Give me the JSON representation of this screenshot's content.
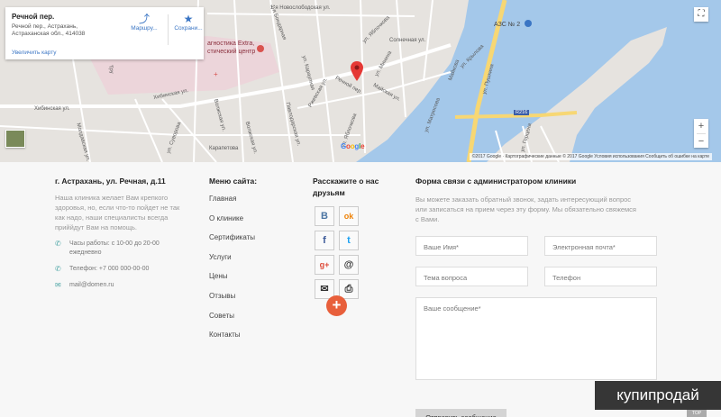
{
  "map": {
    "card": {
      "title": "Речной пер.",
      "address": "Речной пер., Астрахань, Астраханская обл., 414038",
      "enlarge": "Увеличить карту",
      "route": "Маршру...",
      "save": "Сохрани..."
    },
    "labels": {
      "novoslobodskaya": "1-я Новослободская ул.",
      "yablochkova1": "ул. Яблочкова",
      "yablochkova2": "ул. Яблочкова",
      "solnechnaya": "Солнечная ул.",
      "bondarnaya": "1-я Бондарная",
      "khibinskaya1": "Хибинская ул.",
      "khibinskaya2": "Хибинская ул.",
      "tru": "Тру",
      "moldavskaya": "Молдавская ул.",
      "suvorova": "ул. Суворова",
      "volzhskaya1": "Волжская ул.",
      "volzhskaya2": "Волжская ул.",
      "pavlodarskaya": "Павлодарская ул.",
      "karaulnaya": "ул. Караулная",
      "rechnoy": "Речной пер.",
      "mayskaya": "Майская ул.",
      "karapetova": "Карапетова",
      "rzhevskaya": "Ржевская ул.",
      "minina": "ул. Минина",
      "matrosova": "ул. Матросова",
      "maykova": "Майкова",
      "krylova": "ул. Крылова",
      "pushkina": "ул. Пушкина",
      "gertsena": "ул. Герцена",
      "r216": "R216",
      "azs": "АЗС № 2",
      "clinic1": "агностика Extra,",
      "clinic2": "стический центр"
    },
    "footer": "©2017 Google · Картографические данные © 2017 Google     Условия использования     Сообщить об ошибке на карте",
    "google": [
      "G",
      "o",
      "o",
      "g",
      "l",
      "e"
    ],
    "zoom_in": "+",
    "zoom_out": "−",
    "fullscreen": "⛶"
  },
  "contacts": {
    "title": "г. Астрахань, ул. Речная, д.11",
    "about": "Наша клиника желает Вам крепкого здоровья, но, если что-то пойдет не так как надо, наши специалисты всегда приййдут Вам на помощь.",
    "hours": "Часы работы: с 10-00 до 20-00 ежедневно",
    "phone": "Телефон: +7 000 000-00-00",
    "email": "mail@domen.ru"
  },
  "menu": {
    "title": "Меню сайта:",
    "items": [
      "Главная",
      "О клинике",
      "Сертификаты",
      "Услуги",
      "Цены",
      "Отзывы",
      "Советы",
      "Контакты"
    ]
  },
  "share": {
    "title": "Расскажите о нас друзьям",
    "buttons": [
      {
        "icon": "vk-icon",
        "glyph": "B"
      },
      {
        "icon": "odnoklassniki-icon",
        "glyph": "ok"
      },
      {
        "icon": "facebook-icon",
        "glyph": "f"
      },
      {
        "icon": "twitter-icon",
        "glyph": "t"
      },
      {
        "icon": "google-plus-icon",
        "glyph": "g+"
      },
      {
        "icon": "email-at-icon",
        "glyph": "@"
      },
      {
        "icon": "mail-icon",
        "glyph": "✉"
      },
      {
        "icon": "print-icon",
        "glyph": "⎙"
      }
    ],
    "more": "+"
  },
  "form": {
    "title": "Форма связи с администратором клиники",
    "desc": "Вы можете заказать обратный звонок, задать интересующий вопрос или записаться на прием через эту форму. Мы обязательно свяжемся с Вами.",
    "name_ph": "Ваше Имя*",
    "email_ph": "Электронная почта*",
    "subject_ph": "Тема вопроса",
    "phone_ph": "Телефон",
    "message_ph": "Ваше сообщение*",
    "submit": "Отправить сообщение"
  },
  "watermark": "купипродай",
  "top": "TOP",
  "colors": {
    "accent": "#4ea6a6",
    "plus": "#e85f3b",
    "link": "#3a75c4",
    "water": "#a4c8ea"
  }
}
